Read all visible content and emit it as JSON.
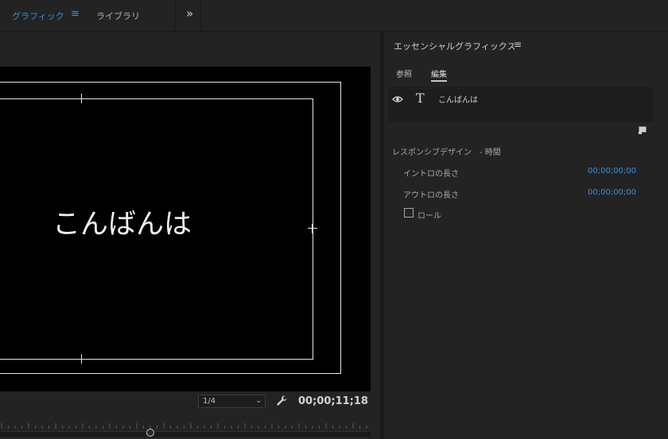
{
  "workspaces": {
    "tabs": [
      {
        "label": "グラフィック",
        "active": true
      },
      {
        "label": "ライブラリ",
        "active": false
      }
    ],
    "menu_icon": "≡",
    "more_icon": "»"
  },
  "monitor": {
    "preview_text": "こんばんは",
    "resolution": "1/4",
    "resolution_chevron": "⌄",
    "timecode": "00;00;11;18"
  },
  "essential_graphics": {
    "title": "エッセンシャルグラフィックス",
    "menu_icon": "≡",
    "tabs": [
      {
        "label": "参照",
        "active": false
      },
      {
        "label": "編集",
        "active": true
      }
    ],
    "layer": {
      "icon": "T",
      "name": "こんばんは"
    },
    "responsive_design": {
      "title": "レスポンシブデザイン　- 時間",
      "intro_label": "イントロの長さ",
      "intro_value": "00;00;00;00",
      "outro_label": "アウトロの長さ",
      "outro_value": "00;00;00;00",
      "roll_label": "ロール",
      "roll_checked": false
    }
  },
  "colors": {
    "accent": "#3d8ee0",
    "panel_bg": "#232323",
    "video_bg": "#000000"
  }
}
